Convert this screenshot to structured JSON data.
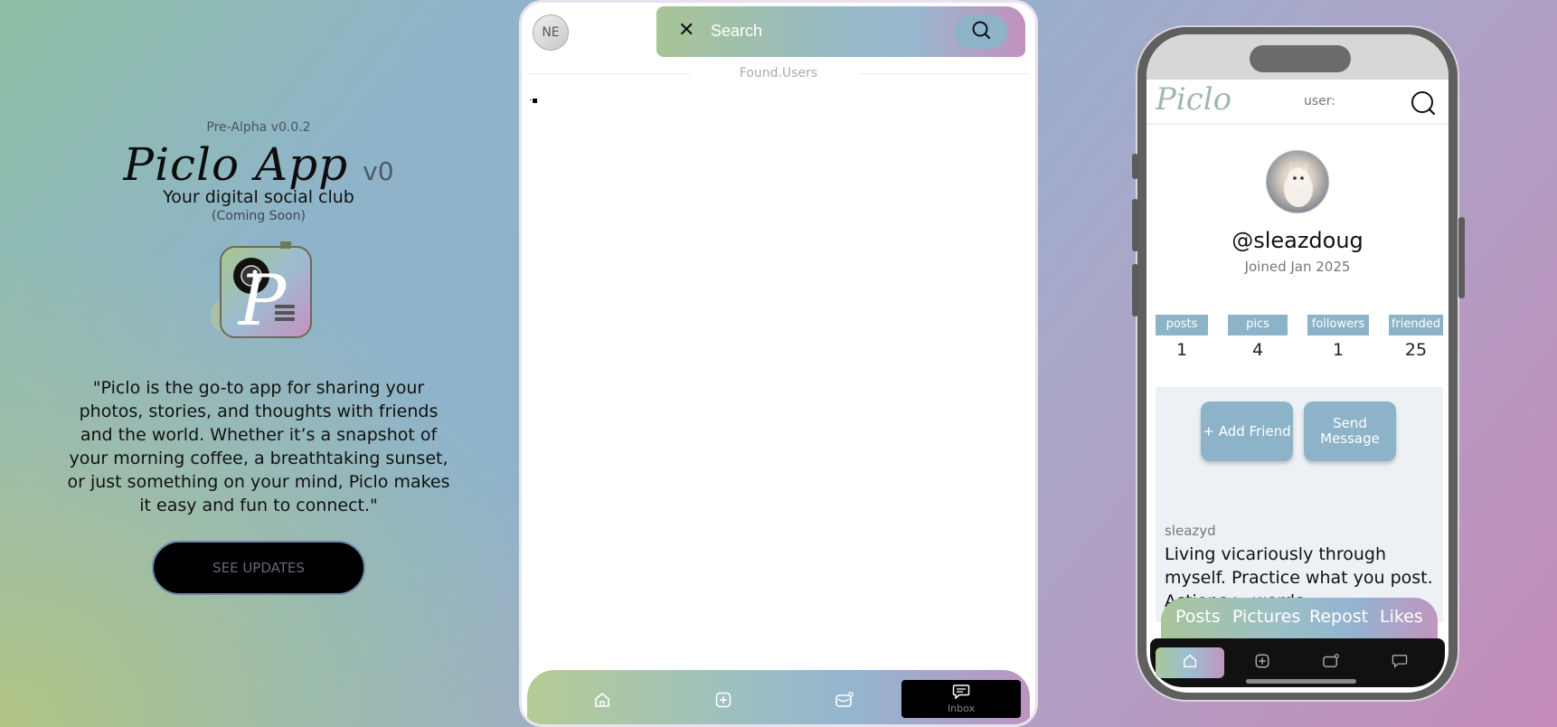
{
  "promo": {
    "version": "Pre-Alpha v0.0.2",
    "app_name": "Piclo App",
    "app_version": "v0",
    "tagline": "Your digital social club",
    "coming_soon": "(Coming Soon)",
    "logo_letter": "P",
    "quote": "\"Piclo is the go-to app for sharing your photos, stories, and thoughts with friends and the world. Whether it’s a snapshot of your morning coffee, a breathtaking sunset, or just something on your mind, Piclo makes it easy and fun to connect.\"",
    "updates_button": "SEE UPDATES"
  },
  "search_panel": {
    "avatar_initials": "NE",
    "close_icon": "close-icon",
    "search_placeholder": "Search",
    "search_icon": "search-icon",
    "found_label": "Found.Users",
    "loader_glyph": "·▪",
    "nav": {
      "home_icon": "home-icon",
      "add_icon": "add-icon",
      "messages_icon": "mail-icon",
      "inbox_icon": "chat-icon",
      "inbox_label": "Inbox"
    }
  },
  "phone": {
    "brand": "Piclo",
    "user_label": "user:",
    "handle": "@sleazdoug",
    "joined": "Joined Jan 2025",
    "stats": [
      {
        "label": "posts",
        "value": "1"
      },
      {
        "label": "pics",
        "value": "4"
      },
      {
        "label": "followers",
        "value": "1"
      },
      {
        "label": "friended",
        "value": "25"
      }
    ],
    "add_friend_button": "+ Add Friend",
    "send_message_button": "Send Message",
    "bio_username": "sleazyd",
    "bio": "Living vicariously through myself. Practice what you post. Actions > words",
    "tabs": [
      "Posts",
      "Pictures",
      "Repost",
      "Likes"
    ]
  },
  "colors": {
    "accent_blue": "#8db3c9",
    "gradient_green": "#a8c59a",
    "gradient_pink": "#c295bf"
  }
}
